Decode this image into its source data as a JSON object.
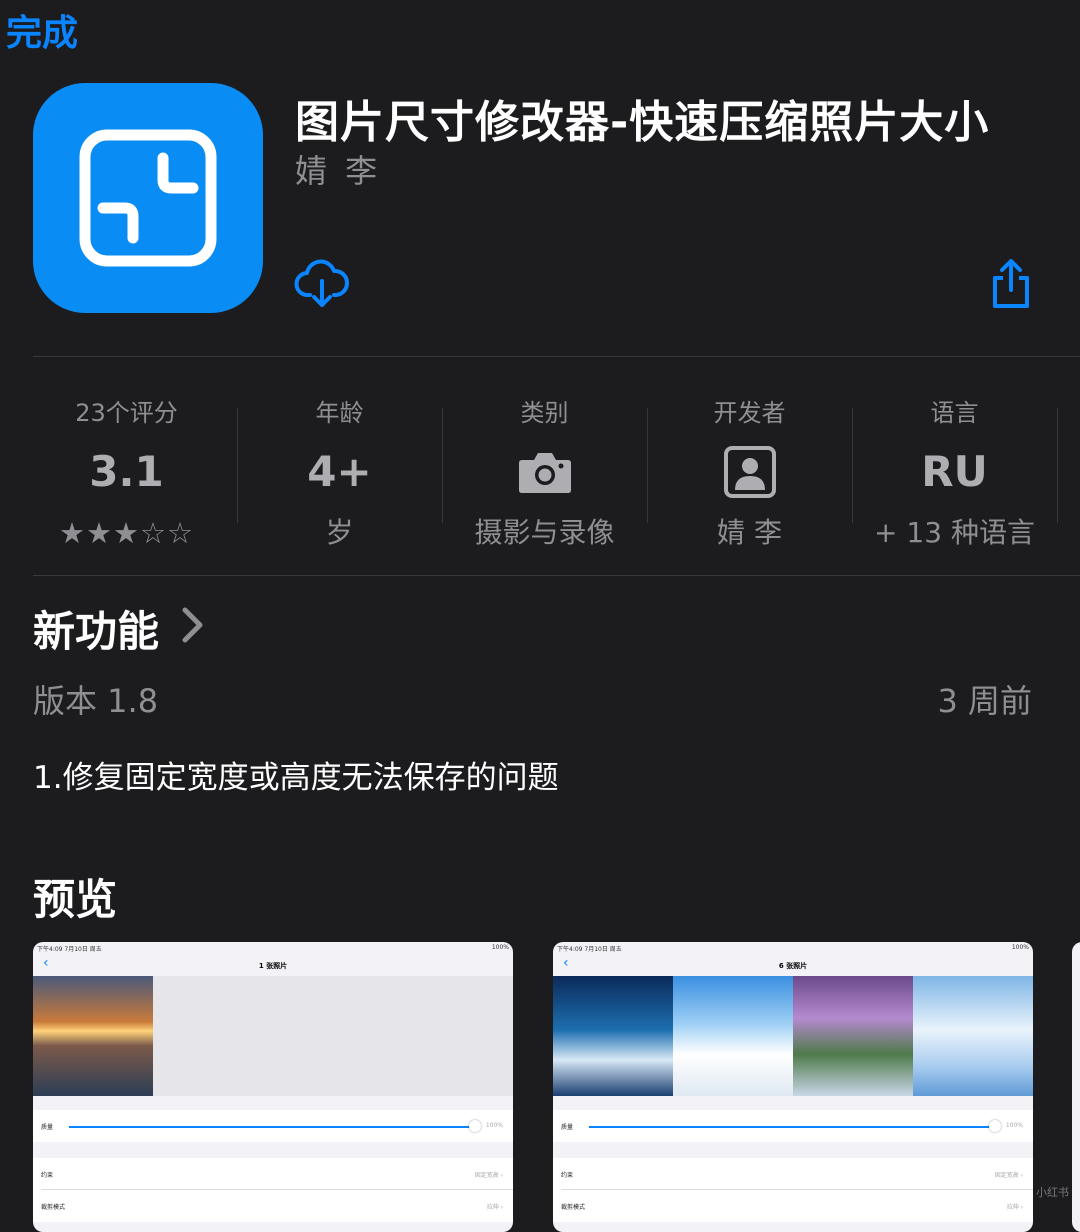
{
  "nav": {
    "done_label": "完成"
  },
  "app": {
    "title": "图片尺寸修改器-快速压缩照片大小",
    "developer": "婧 李",
    "icon": "resize-icon"
  },
  "info": {
    "ratings": {
      "label": "23个评分",
      "value": "3.1",
      "rating": 3,
      "max": 5,
      "stars_text": "★★★☆☆"
    },
    "age": {
      "label": "年龄",
      "value": "4+",
      "sub": "岁"
    },
    "category": {
      "label": "类别",
      "icon": "camera-icon",
      "sub": "摄影与录像"
    },
    "developer": {
      "label": "开发者",
      "icon": "person-icon",
      "sub": "婧 李"
    },
    "language": {
      "label": "语言",
      "value": "RU",
      "sub": "+ 13 种语言"
    }
  },
  "whats_new": {
    "title": "新功能",
    "version": "版本 1.8",
    "ago": "3 周前",
    "notes": "1.修复固定宽度或高度无法保存的问题"
  },
  "preview": {
    "title": "预览",
    "screenshots": [
      {
        "status_left": "下午4:09 7月10日 周五",
        "status_right": "100%",
        "nav_title": "1 张照片",
        "quality_label": "质量",
        "quality_value": "100%",
        "quality_level": 1.0,
        "constraint_label": "约束",
        "constraint_value": "固定宽高 ›",
        "crop_label": "裁剪模式",
        "crop_value": "拉伸 ›"
      },
      {
        "status_left": "下午4:09 7月10日 周五",
        "status_right": "100%",
        "nav_title": "6 张照片",
        "quality_label": "质量",
        "quality_value": "100%",
        "quality_level": 1.0,
        "constraint_label": "约束",
        "constraint_value": "固定宽高 ›",
        "crop_label": "裁剪模式",
        "crop_value": "拉伸 ›"
      }
    ]
  },
  "watermark": "小红书",
  "colors": {
    "accent": "#0a84ff",
    "background": "#1c1c1e",
    "secondary_text": "#8e8e93",
    "icon_bg": "#0a8cf5"
  }
}
